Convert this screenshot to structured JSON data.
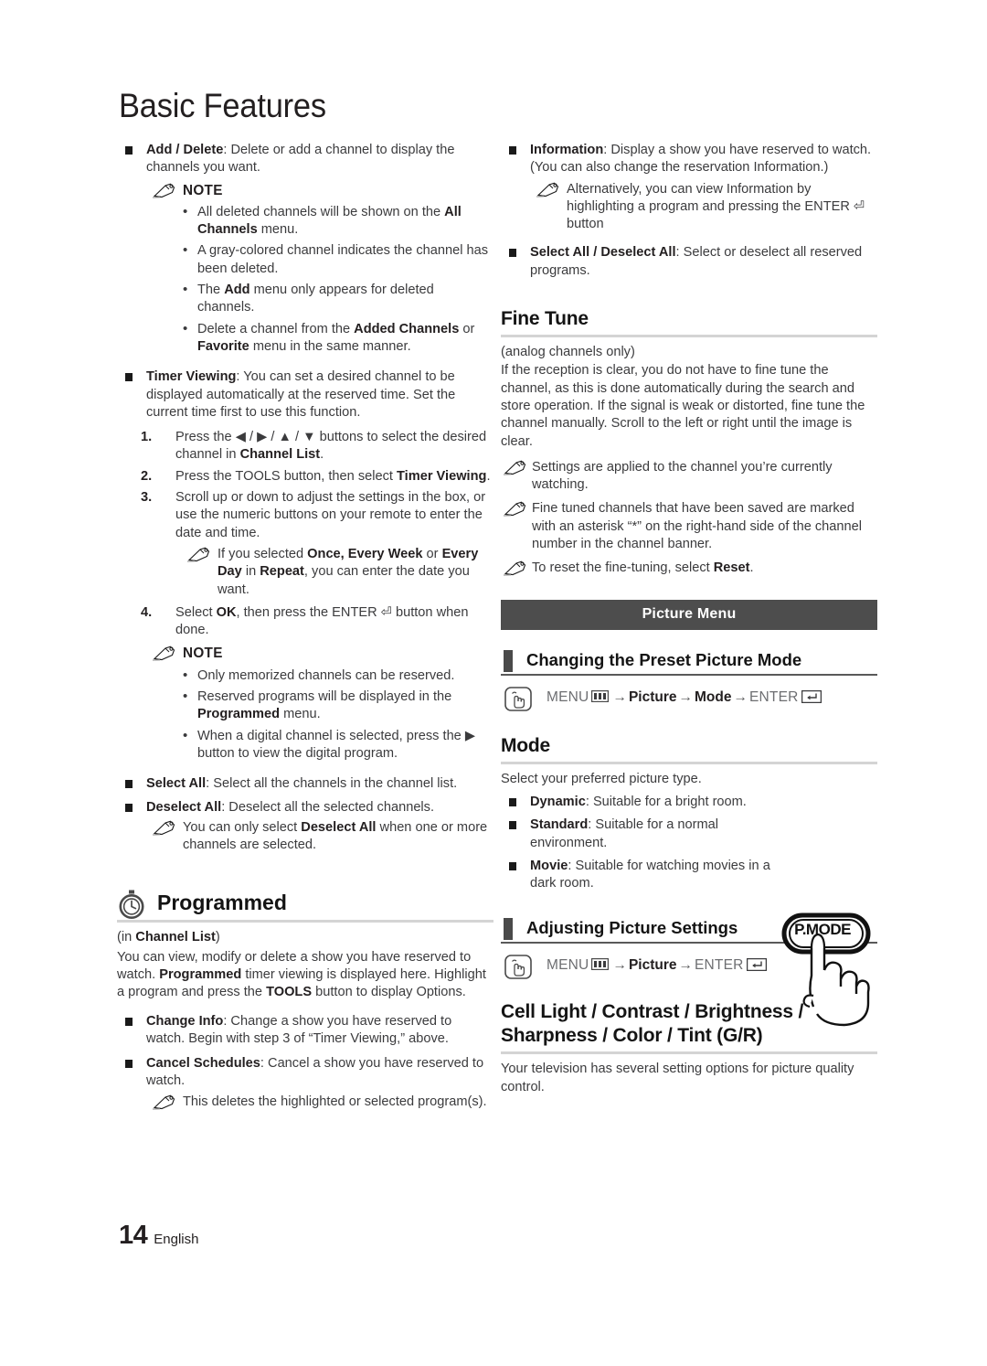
{
  "document": {
    "title": "Basic Features",
    "page_number": "14",
    "language": "English"
  },
  "left_column": {
    "add_delete": {
      "term": "Add / Delete",
      "text": ": Delete or add a channel to display the channels you want.",
      "note_label": "NOTE",
      "notes": [
        {
          "pre": "All deleted channels will be shown on the ",
          "bold": "All Channels",
          "post": " menu."
        },
        {
          "pre": "A gray-colored channel indicates the channel has been deleted.",
          "bold": "",
          "post": ""
        },
        {
          "pre": "The ",
          "bold": "Add",
          "post": " menu only appears for deleted channels."
        },
        {
          "pre": "Delete a channel from the ",
          "bold": "Added Channels",
          "mid": " or ",
          "bold2": "Favorite",
          "post": " menu in the same manner."
        }
      ]
    },
    "timer_viewing": {
      "term": "Timer Viewing",
      "text": ": You can set a desired channel to be displayed automatically at the reserved time. Set the current time first to use this function.",
      "steps": [
        {
          "num": "1.",
          "pre": "Press the ◀ / ▶ / ▲ / ▼ buttons to select the desired channel in ",
          "bold": "Channel List",
          "post": "."
        },
        {
          "num": "2.",
          "pre": "Press the TOOLS button, then select ",
          "bold": "Timer Viewing",
          "post": "."
        },
        {
          "num": "3.",
          "pre": "Scroll up or down to adjust the settings in the box, or use the numeric buttons on your remote to enter the date and time.",
          "bold": "",
          "post": ""
        },
        {
          "num": "4.",
          "pre": "Select ",
          "bold": "OK",
          "post": ", then press the ENTER ⏎ button when done."
        }
      ],
      "step3_note": {
        "pre": "If you selected ",
        "bold": "Once, Every Week",
        "mid": " or ",
        "bold2": "Every Day",
        "mid2": " in ",
        "bold3": "Repeat",
        "post": ", you can enter the date you want."
      },
      "note_label": "NOTE",
      "notes": [
        {
          "pre": "Only memorized channels can be reserved.",
          "bold": "",
          "post": ""
        },
        {
          "pre": "Reserved programs will be displayed in the ",
          "bold": "Programmed",
          "post": " menu."
        },
        {
          "pre": "When a digital channel is selected, press the ▶ button to view the digital program.",
          "bold": "",
          "post": ""
        }
      ]
    },
    "select_all": {
      "term": "Select All",
      "text": ": Select all the channels in the channel list."
    },
    "deselect_all": {
      "term": "Deselect All",
      "text": ": Deselect all the selected channels.",
      "note": {
        "pre": "You can only select ",
        "bold": "Deselect All",
        "post": " when one or more channels are selected."
      }
    },
    "programmed": {
      "heading": "Programmed",
      "icon": "clock-icon",
      "subtitle_pre": "(in ",
      "subtitle_bold": "Channel List",
      "subtitle_post": ")",
      "body_1": "You can view, modify or delete a show you have reserved to watch. ",
      "body_bold_1": "Programmed",
      "body_2": " timer viewing is displayed here. Highlight a program and press the ",
      "body_bold_2": "TOOLS",
      "body_3": " button to display Options.",
      "items": [
        {
          "term": "Change Info",
          "text": ": Change a show you have reserved to watch. Begin with step 3 of “Timer Viewing,” above."
        },
        {
          "term": "Cancel Schedules",
          "text": ": Cancel a show you have reserved to watch."
        }
      ],
      "cancel_note": "This deletes the highlighted or selected program(s)."
    }
  },
  "right_column": {
    "information": {
      "term": "Information",
      "text": ": Display a show you have reserved to watch. (You can also change the reservation Information.)",
      "note": "Alternatively, you can view Information by highlighting a program and pressing the ENTER ⏎ button"
    },
    "select_deselect_all": {
      "term": "Select All / Deselect All",
      "text": ": Select or deselect all reserved programs."
    },
    "fine_tune": {
      "heading": "Fine Tune",
      "subtitle": "(analog channels only)",
      "body": "If the reception is clear, you do not have to fine tune the channel, as this is done automatically during the search and store operation. If the signal is weak or distorted, fine tune the channel manually. Scroll to the left or right until the image is clear.",
      "notes": [
        {
          "pre": "Settings are applied to the channel you’re currently watching.",
          "bold": "",
          "post": ""
        },
        {
          "pre": "Fine tuned channels that have been saved are marked with an asterisk “*” on the right-hand side of the channel number in the channel banner.",
          "bold": "",
          "post": ""
        },
        {
          "pre": "To reset the fine-tuning, select ",
          "bold": "Reset",
          "post": "."
        }
      ]
    },
    "picture_menu_banner": "Picture Menu",
    "changing_preset": {
      "heading": "Changing the Preset Picture Mode",
      "path": {
        "menu": "MENU",
        "items": [
          "Picture",
          "Mode"
        ],
        "enter": "ENTER"
      }
    },
    "mode": {
      "heading": "Mode",
      "intro": "Select your preferred picture type.",
      "options": [
        {
          "term": "Dynamic",
          "text": ": Suitable for a bright room."
        },
        {
          "term": "Standard",
          "text": ": Suitable for a normal environment."
        },
        {
          "term": "Movie",
          "text": ": Suitable for watching movies in a dark room."
        }
      ],
      "remote_button_label": "P.MODE"
    },
    "adjusting_picture": {
      "heading": "Adjusting Picture Settings",
      "path": {
        "menu": "MENU",
        "items": [
          "Picture"
        ],
        "enter": "ENTER"
      }
    },
    "cell_light": {
      "heading_line1": "Cell Light / Contrast / Brightness /",
      "heading_line2": "Sharpness / Color / Tint (G/R)",
      "body": "Your television has several setting options for picture quality control."
    }
  },
  "colors": {
    "banner_bg": "#4d4d4d",
    "text": "#3b3b3d",
    "heading": "#141414",
    "rule": "#d4d4d4",
    "marker": "#4a4a4a"
  }
}
